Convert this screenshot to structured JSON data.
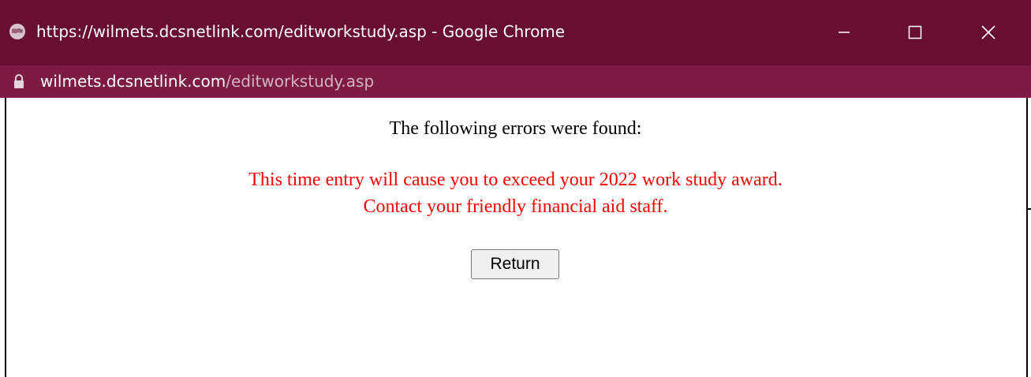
{
  "window": {
    "title": "https://wilmets.dcsnetlink.com/editworkstudy.asp - Google Chrome",
    "title_icon": "globe-icon",
    "controls": [
      "minimize-icon",
      "maximize-icon",
      "close-icon"
    ]
  },
  "address_bar": {
    "lock_icon": "lock-icon",
    "host": "wilmets.dcsnetlink.com",
    "path": "/editworkstudy.asp"
  },
  "page": {
    "heading": "The following errors were found:",
    "error_lines": [
      "This time entry will cause you to exceed your 2022 work study award.",
      "Contact your friendly financial aid staff."
    ],
    "return_button": "Return"
  },
  "colors": {
    "titlebar": "#680d33",
    "addressbar": "#7d1a45",
    "error_text": "#ff0000"
  }
}
